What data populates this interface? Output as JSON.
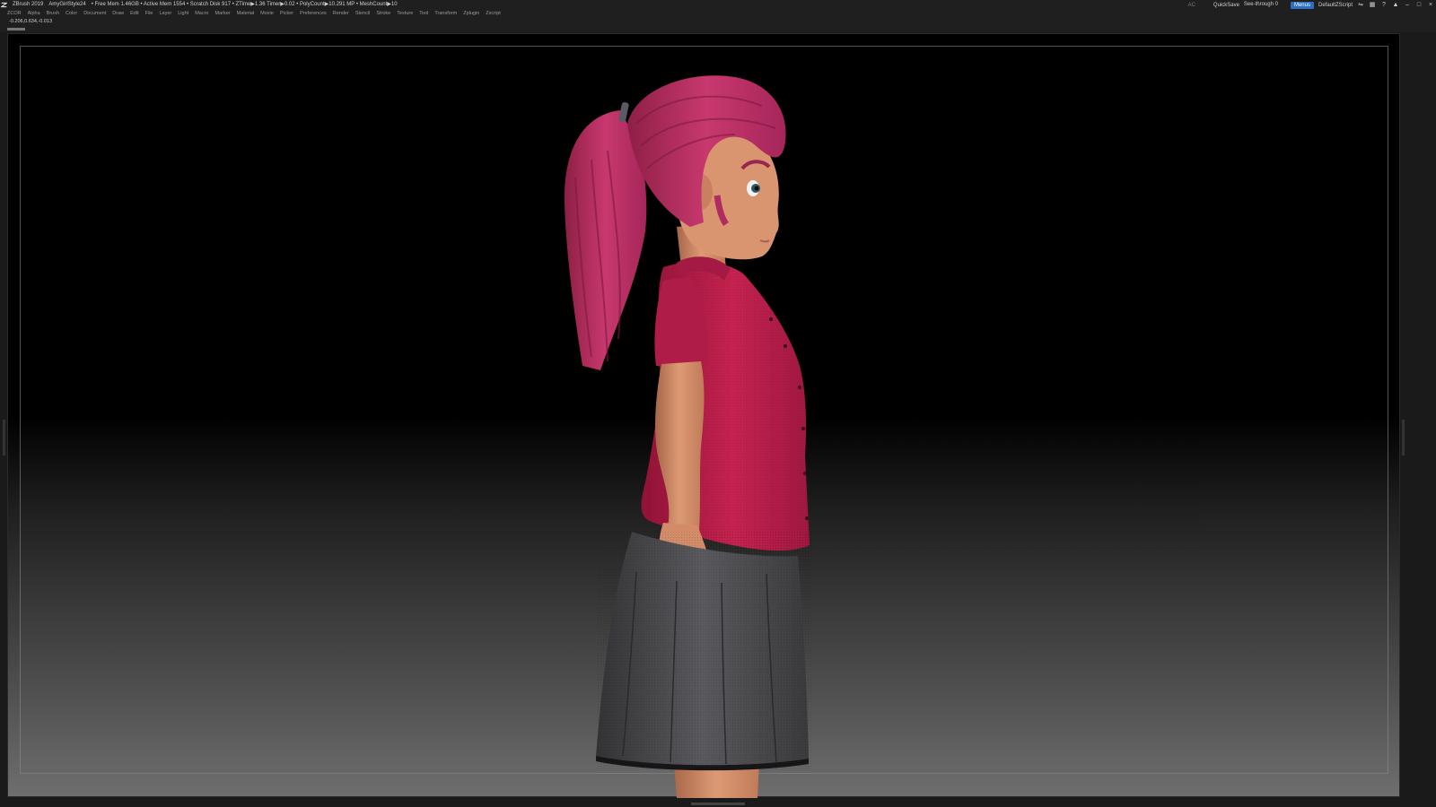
{
  "titlebar": {
    "app_name": "ZBrush 2019",
    "document": "AmyGirlStyle24",
    "stats": "• Free Mem 1.46GB • Active Mem 1554 • Scratch Disk 917 • ZTime▶1.36 Timer▶0.02 • PolyCount▶10.291 MP • MeshCount▶10",
    "ac": "AC",
    "quicksave": "QuickSave",
    "see_through_label": "See-through",
    "see_through_value": "0",
    "see_through_fraction": 0.25,
    "menus_button": "Menus",
    "zscript": "DefaultZScript"
  },
  "menubar": {
    "items": [
      "ZCOR",
      "Alpha",
      "Brush",
      "Color",
      "Document",
      "Draw",
      "Edit",
      "File",
      "Layer",
      "Light",
      "Macro",
      "Marker",
      "Material",
      "Movie",
      "Picker",
      "Preferences",
      "Render",
      "Stencil",
      "Stroke",
      "Texture",
      "Tool",
      "Transform",
      "Zplugin",
      "Zscript"
    ]
  },
  "infobar": {
    "coords": "-0.206,0.634,-0.013"
  },
  "colors": {
    "accent": "#2f6fc0",
    "hair": "#c2346a",
    "shirt": "#c01f4e",
    "skin": "#d9906a",
    "skirt": "#4a4a4e"
  }
}
